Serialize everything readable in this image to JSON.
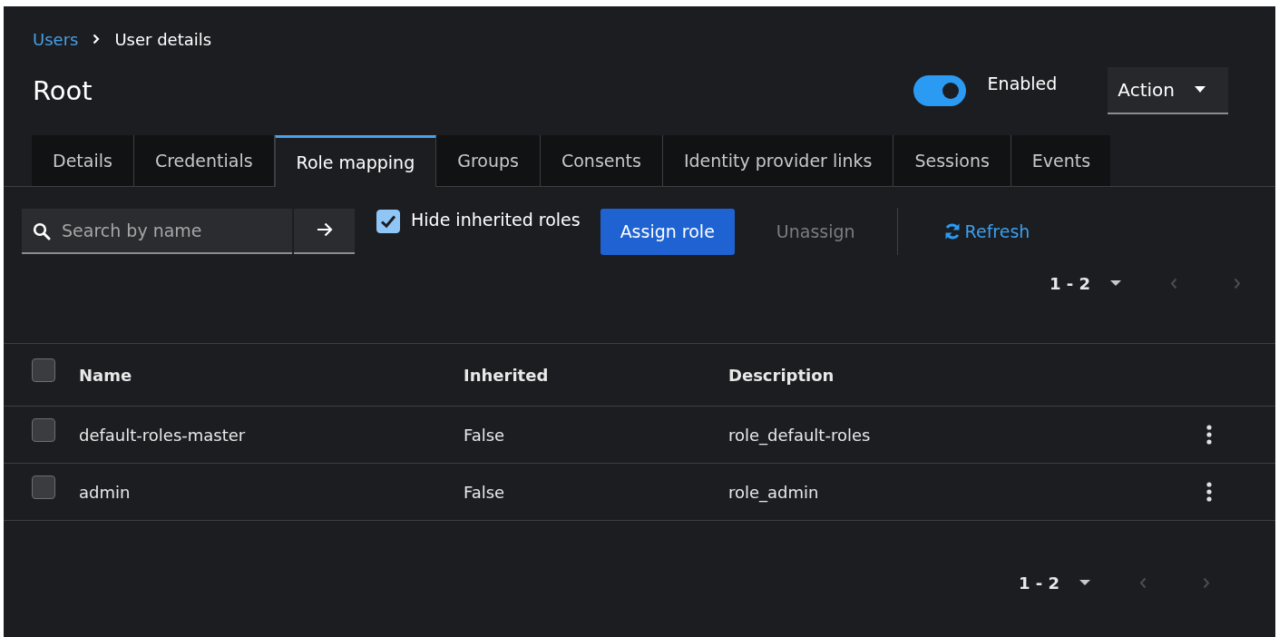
{
  "breadcrumb": [
    {
      "label": "Users",
      "link": true
    },
    {
      "label": "User details",
      "link": false
    }
  ],
  "title": "Root",
  "enabled_switch": {
    "label": "Enabled",
    "on": true
  },
  "action_menu": {
    "label": "Action"
  },
  "tabs": [
    {
      "label": "Details",
      "selected": false
    },
    {
      "label": "Credentials",
      "selected": false
    },
    {
      "label": "Role mapping",
      "selected": true
    },
    {
      "label": "Groups",
      "selected": false
    },
    {
      "label": "Consents",
      "selected": false
    },
    {
      "label": "Identity provider links",
      "selected": false
    },
    {
      "label": "Sessions",
      "selected": false
    },
    {
      "label": "Events",
      "selected": false
    }
  ],
  "toolbar": {
    "search": {
      "placeholder": "Search by name"
    },
    "hide_inherited": {
      "label": "Hide inherited roles",
      "checked": true
    },
    "assign_button": "Assign role",
    "unassign_button": {
      "label": "Unassign",
      "disabled": true
    },
    "refresh_button": "Refresh"
  },
  "pagination_top": {
    "range": "1 - 2"
  },
  "table": {
    "columns": [
      "Name",
      "Inherited",
      "Description"
    ],
    "header_checked": false,
    "rows": [
      {
        "name": "default-roles-master",
        "inherited": "False",
        "description": "role_default-roles",
        "checked": false
      },
      {
        "name": "admin",
        "inherited": "False",
        "description": "role_admin",
        "checked": false
      }
    ]
  },
  "pagination_bottom": {
    "range": "1 - 2"
  }
}
